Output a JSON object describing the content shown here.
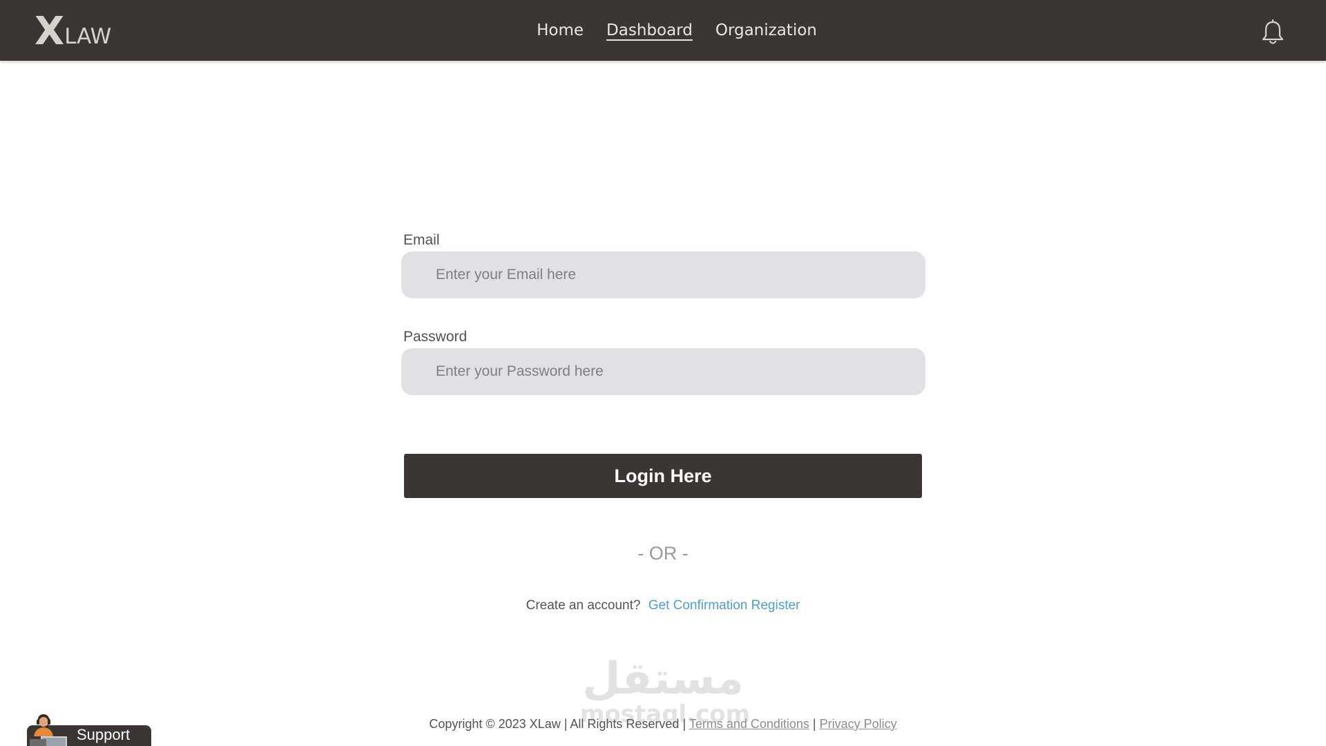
{
  "header": {
    "logo": {
      "x": "X",
      "law": "LAW"
    },
    "nav": [
      {
        "label": "Home",
        "active": false
      },
      {
        "label": "Dashboard",
        "active": true
      },
      {
        "label": "Organization",
        "active": false
      }
    ],
    "icons": {
      "notifications": "bell-icon"
    },
    "background_color": "#3b3633"
  },
  "form": {
    "email_label": "Email",
    "email_placeholder": "Enter your Email here",
    "password_label": "Password",
    "password_placeholder": "Enter your Password here",
    "login_label": "Login Here",
    "or_text": "- OR -",
    "create_prompt": "Create an account?",
    "register_link": "Get Confirmation Register",
    "link_color": "#4a9fd9"
  },
  "watermark": {
    "arabic": "مستقل",
    "latin": "mostaql.com"
  },
  "footer": {
    "copyright": "Copyright © 2023 XLaw | All Rights Reserved |",
    "terms": "Terms and Conditions",
    "separator": "|",
    "privacy": "Privacy Policy"
  },
  "support": {
    "label": "Support",
    "icon": "support-agent-icon"
  }
}
